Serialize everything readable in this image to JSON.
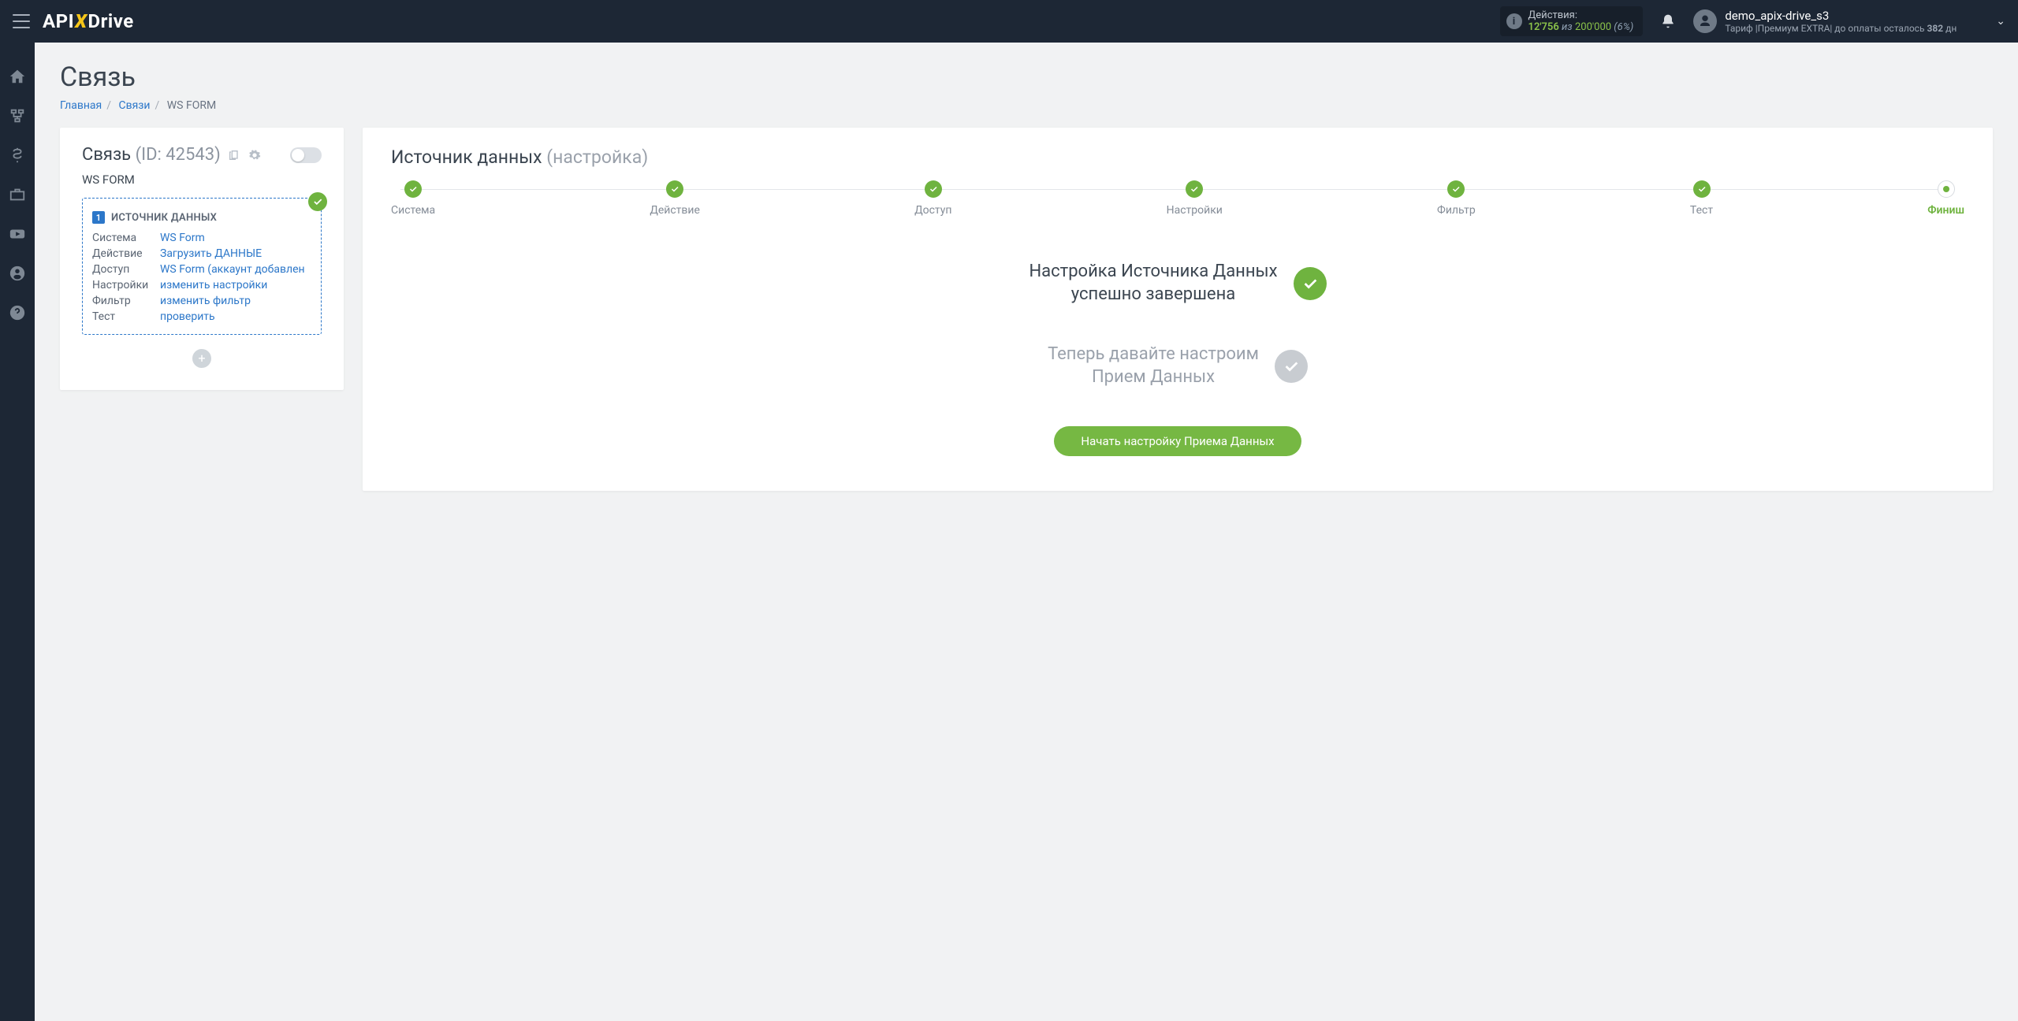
{
  "header": {
    "logo": {
      "p1": "API",
      "p2": "X",
      "p3": "Drive"
    },
    "actions": {
      "label": "Действия:",
      "used": "12'756",
      "of": "из",
      "total": "200'000",
      "pct": "(6%)"
    },
    "user": {
      "name": "demo_apix-drive_s3",
      "plan_prefix": "Тариф |Премиум EXTRA| до оплаты осталось ",
      "plan_days": "382",
      "plan_suffix": " дн"
    }
  },
  "page": {
    "title": "Связь",
    "breadcrumbs": {
      "home": "Главная",
      "links": "Связи",
      "current": "WS FORM"
    }
  },
  "left": {
    "title": "Связь",
    "id_label": "(ID: 42543)",
    "name": "WS FORM",
    "source_heading": "ИСТОЧНИК ДАННЫХ",
    "rows": [
      {
        "k": "Система",
        "v": "WS Form"
      },
      {
        "k": "Действие",
        "v": "Загрузить ДАННЫЕ"
      },
      {
        "k": "Доступ",
        "v": "WS Form (аккаунт добавлен"
      },
      {
        "k": "Настройки",
        "v": "изменить настройки"
      },
      {
        "k": "Фильтр",
        "v": "изменить фильтр"
      },
      {
        "k": "Тест",
        "v": "проверить"
      }
    ]
  },
  "right": {
    "title": "Источник данных",
    "title_sub": "(настройка)",
    "steps": [
      "Система",
      "Действие",
      "Доступ",
      "Настройки",
      "Фильтр",
      "Тест",
      "Финиш"
    ],
    "done1_l1": "Настройка Источника Данных",
    "done1_l2": "успешно завершена",
    "done2_l1": "Теперь давайте настроим",
    "done2_l2": "Прием Данных",
    "cta": "Начать настройку Приема Данных"
  }
}
